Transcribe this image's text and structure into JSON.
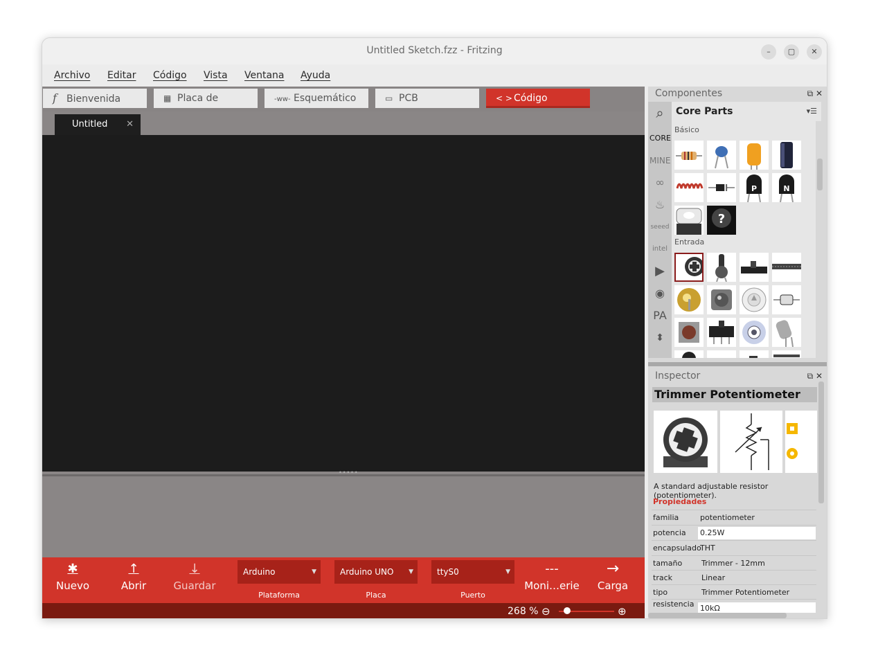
{
  "window": {
    "title": "Untitled Sketch.fzz - Fritzing",
    "minimize": "–",
    "maximize": "▢",
    "close": "✕"
  },
  "menu": [
    "Archivo",
    "Editar",
    "Código",
    "Vista",
    "Ventana",
    "Ayuda"
  ],
  "tabs": [
    {
      "label": "Bienvenida",
      "icon": "f"
    },
    {
      "label": "Placa de pruebas",
      "icon": "▦"
    },
    {
      "label": "Esquemático",
      "icon": "-ww-"
    },
    {
      "label": "PCB",
      "icon": "▭"
    },
    {
      "label": "Código",
      "icon": "< >"
    }
  ],
  "active_tab": "Código",
  "doc_tab": {
    "label": "Untitled",
    "close": "✕"
  },
  "toolbar": {
    "new": {
      "label": "Nuevo",
      "icon": "✱"
    },
    "open": {
      "label": "Abrir",
      "icon": "↑"
    },
    "save": {
      "label": "Guardar",
      "icon": "↓"
    },
    "platform": {
      "value": "Arduino",
      "label": "Plataforma"
    },
    "board": {
      "value": "Arduino UNO",
      "label": "Placa"
    },
    "port": {
      "value": "ttyS0",
      "label": "Puerto"
    },
    "monitor": {
      "label": "Moni…erie",
      "icon": "---"
    },
    "upload": {
      "label": "Carga",
      "icon": "→"
    }
  },
  "status": {
    "zoom": "268 %",
    "zoom_out": "⊖",
    "zoom_in": "⊕",
    "zoom_level": 0.05
  },
  "components": {
    "title": "Componentes",
    "bin_title": "Core Parts",
    "bins": [
      "CORE",
      "MINE"
    ],
    "sections": [
      "Básico",
      "Entrada"
    ],
    "unknown_part_glyph": "?"
  },
  "inspector": {
    "title": "Inspector",
    "part_title": "Trimmer Potentiometer",
    "description": "A standard adjustable resistor (potentiometer).",
    "props_label": "Propiedades",
    "props": [
      {
        "k": "familia",
        "v": "potentiometer"
      },
      {
        "k": "potencia",
        "v": "0.25W"
      },
      {
        "k": "encapsulado",
        "v": "THT"
      },
      {
        "k": "tamaño",
        "v": "Trimmer - 12mm"
      },
      {
        "k": "track",
        "v": "Linear"
      },
      {
        "k": "tipo",
        "v": "Trimmer Potentiometer"
      },
      {
        "k": "resistencia",
        "v": "10kΩ"
      }
    ]
  },
  "colors": {
    "accent": "#d1342a",
    "accent_dark": "#a72219",
    "status": "#7a1a10",
    "editor_bg": "#1c1c1c"
  }
}
